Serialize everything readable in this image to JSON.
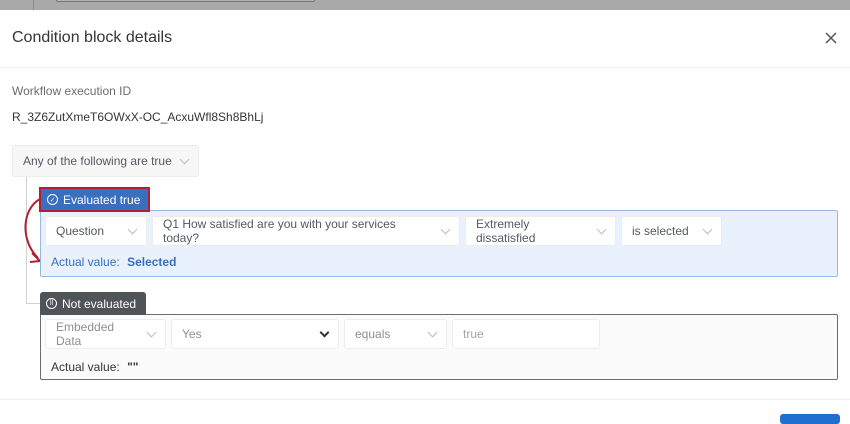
{
  "modal": {
    "title": "Condition block details",
    "close_icon": "close-icon",
    "execution_label": "Workflow execution ID",
    "execution_id": "R_3Z6ZutXmeT6OWxX-OC_AcxuWfl8Sh8BhLj",
    "conjunction": "Any of the following are true",
    "conditions": [
      {
        "status": "Evaluated true",
        "fields": [
          "Question",
          "Q1 How satisfied are you with your services today?",
          "Extremely dissatisfied",
          "is selected"
        ],
        "actual_label": "Actual value:",
        "actual_value": "Selected"
      },
      {
        "status": "Not evaluated",
        "fields": [
          "Embedded Data",
          "Yes",
          "equals",
          "true"
        ],
        "actual_label": "Actual value:",
        "actual_value": "\"\""
      }
    ]
  },
  "colors": {
    "evaluated_true": "#3a6fbf",
    "highlight": "#b11f32",
    "not_evaluated": "#4f5459"
  }
}
